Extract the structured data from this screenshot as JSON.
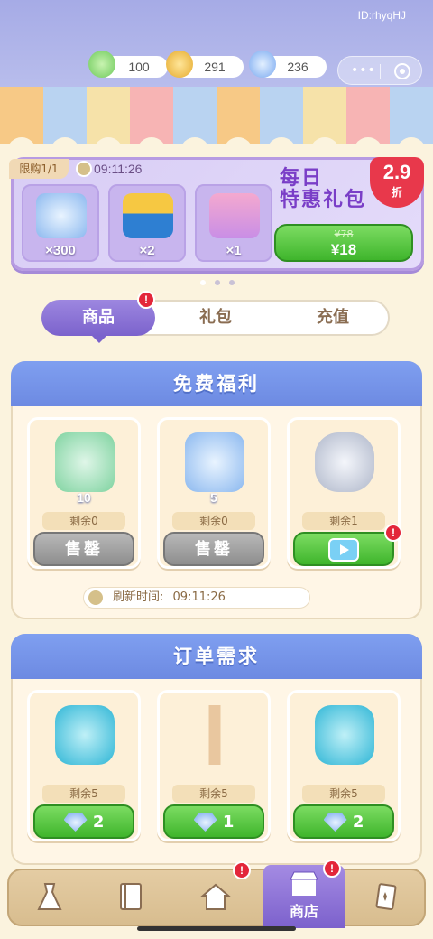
{
  "header": {
    "user_id": "ID:rhyqHJ",
    "resources": [
      {
        "name": "energy",
        "icon": "lightning-plus-icon",
        "value": "100"
      },
      {
        "name": "coins",
        "icon": "gold-coin-icon",
        "value": "291"
      },
      {
        "name": "diamonds",
        "icon": "diamond-plus-icon",
        "value": "236"
      }
    ],
    "capsule": {
      "more": "•••",
      "close_icon": "target-circle-icon"
    }
  },
  "daily_pack": {
    "limit_label": "限购1/1",
    "timer": "09:11:26",
    "items": [
      {
        "icon": "diamond-chest-icon",
        "qty": "×300"
      },
      {
        "icon": "energy-box-icon",
        "qty": "×2"
      },
      {
        "icon": "gift-box-icon",
        "qty": "×1"
      }
    ],
    "title_line1": "每日",
    "title_line2": "特惠礼包",
    "discount": "2.9",
    "discount_suffix": "折",
    "old_price": "¥78",
    "price": "¥18",
    "page_dots": 3
  },
  "tabs": [
    {
      "label": "商品",
      "active": true,
      "badge": "!"
    },
    {
      "label": "礼包",
      "active": false
    },
    {
      "label": "充值",
      "active": false
    }
  ],
  "free_section": {
    "title": "免费福利",
    "cards": [
      {
        "icon": "green-gem-chest-icon",
        "count": "10",
        "remain": "剩余0",
        "button": "售罄",
        "button_type": "gray"
      },
      {
        "icon": "diamond-chest-icon",
        "count": "5",
        "remain": "剩余0",
        "button": "售罄",
        "button_type": "gray"
      },
      {
        "icon": "piggy-bank-icon",
        "count": "",
        "remain": "剩余1",
        "button": "",
        "button_icon": "video-play-icon",
        "button_type": "green",
        "badge": "!"
      }
    ],
    "refresh_label": "刷新时间:",
    "refresh_time": "09:11:26"
  },
  "order_section": {
    "title": "订单需求",
    "cards": [
      {
        "icon": "blue-cuff-icon",
        "remain": "剩余5",
        "price": "2",
        "price_icon": "diamond-icon"
      },
      {
        "icon": "lipstick-icon",
        "remain": "剩余5",
        "price": "1",
        "price_icon": "diamond-icon"
      },
      {
        "icon": "blue-cuff-icon",
        "remain": "剩余5",
        "price": "2",
        "price_icon": "diamond-icon"
      }
    ]
  },
  "bottom_nav": [
    {
      "icon": "dress-icon",
      "label": ""
    },
    {
      "icon": "book-icon",
      "label": ""
    },
    {
      "icon": "home-icon",
      "label": "",
      "badge": "!"
    },
    {
      "icon": "shop-icon",
      "label": "商店",
      "active": true,
      "badge": "!"
    },
    {
      "icon": "cards-icon",
      "label": ""
    }
  ],
  "colors": {
    "accent_purple": "#7b62cc",
    "header_blue": "#6d8ae2",
    "green": "#3fb52c",
    "badge_red": "#e3263a"
  }
}
